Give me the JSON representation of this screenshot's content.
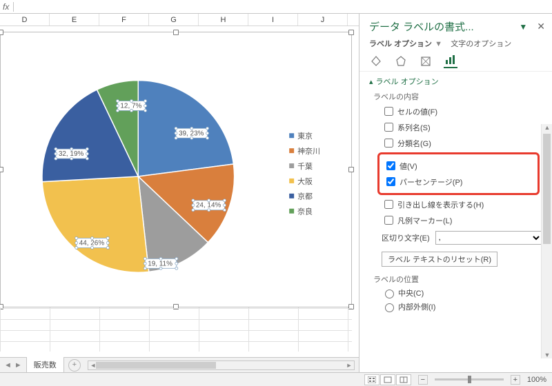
{
  "formula_bar": {
    "fx_label": "fx"
  },
  "columns": [
    "D",
    "E",
    "F",
    "G",
    "H",
    "I",
    "J"
  ],
  "chart_data": {
    "type": "pie",
    "title": "",
    "series": [
      {
        "name": "東京",
        "value": 39,
        "percent": "23%",
        "color": "#4f81bd"
      },
      {
        "name": "神奈川",
        "value": 24,
        "percent": "14%",
        "color": "#d97f3d"
      },
      {
        "name": "千葉",
        "value": 19,
        "percent": "11%",
        "color": "#9d9d9d"
      },
      {
        "name": "大阪",
        "value": 44,
        "percent": "26%",
        "color": "#f2c14e"
      },
      {
        "name": "京都",
        "value": 32,
        "percent": "19%",
        "color": "#3a5fa0"
      },
      {
        "name": "奈良",
        "value": 12,
        "percent": "7%",
        "color": "#62a05a"
      }
    ],
    "data_label_format": "value, percent"
  },
  "pane": {
    "title": "データ ラベルの書式...",
    "subtab_primary": "ラベル オプション",
    "subtab_secondary": "文字のオプション",
    "section_title": "ラベル オプション",
    "group_label_content": "ラベルの内容",
    "checkbox_cell_value": "セルの値(F)",
    "checkbox_series_name": "系列名(S)",
    "checkbox_category_name": "分類名(G)",
    "checkbox_value": "値(V)",
    "checkbox_percentage": "パーセンテージ(P)",
    "checkbox_leader_lines": "引き出し線を表示する(H)",
    "checkbox_legend_marker": "凡例マーカー(L)",
    "separator_label": "区切り文字(E)",
    "separator_value": ",",
    "reset_button": "ラベル テキストのリセット(R)",
    "group_label_position": "ラベルの位置",
    "radio_center": "中央(C)",
    "radio_inside_end": "内部外側(I)"
  },
  "sheet_tabs": {
    "tab1": "販売数"
  },
  "status": {
    "zoom_label": "100%"
  }
}
